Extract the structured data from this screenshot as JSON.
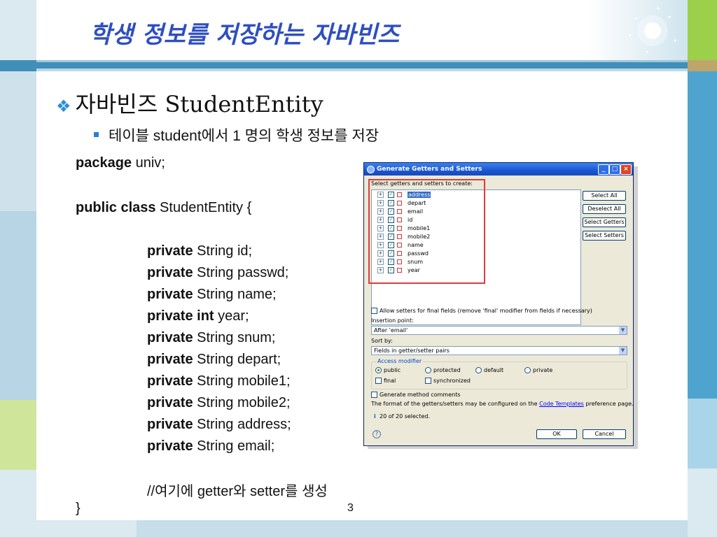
{
  "slide": {
    "title": "학생 정보를 저장하는 자바빈즈",
    "bullet1": "자바빈즈 StudentEntity",
    "bullet2": "테이블 student에서 1 명의 학생 정보를 저장",
    "page_number": "3"
  },
  "code": {
    "package_kw": "package",
    "package_rest": " univ;",
    "class_kw": "public class",
    "class_rest": " StudentEntity {",
    "fields": [
      {
        "kw": "private",
        "rest": " String id;"
      },
      {
        "kw": "private",
        "rest": " String passwd;"
      },
      {
        "kw": "private",
        "rest": " String name;"
      },
      {
        "kw": "private int",
        "rest": " year;"
      },
      {
        "kw": "private",
        "rest": " String snum;"
      },
      {
        "kw": "private",
        "rest": " String depart;"
      },
      {
        "kw": "private",
        "rest": " String mobile1;"
      },
      {
        "kw": "private",
        "rest": " String mobile2;"
      },
      {
        "kw": "private",
        "rest": " String address;"
      },
      {
        "kw": "private",
        "rest": " String email;"
      }
    ],
    "comment": "//여기에 getter와 setter를 생성",
    "close": "}"
  },
  "dialog": {
    "title": "Generate Getters and Setters",
    "select_label": "Select getters and setters to create:",
    "fields": [
      {
        "name": "address",
        "selected": true
      },
      {
        "name": "depart",
        "selected": false
      },
      {
        "name": "email",
        "selected": false
      },
      {
        "name": "id",
        "selected": false
      },
      {
        "name": "mobile1",
        "selected": false
      },
      {
        "name": "mobile2",
        "selected": false
      },
      {
        "name": "name",
        "selected": false
      },
      {
        "name": "passwd",
        "selected": false
      },
      {
        "name": "snum",
        "selected": false
      },
      {
        "name": "year",
        "selected": false
      }
    ],
    "buttons": {
      "select_all": "Select All",
      "deselect_all": "Deselect All",
      "select_getters": "Select Getters",
      "select_setters": "Select Setters",
      "ok": "OK",
      "cancel": "Cancel"
    },
    "allow_setters": "Allow setters for final fields (remove 'final' modifier from fields if necessary)",
    "insertion_label": "Insertion point:",
    "insertion_value": "After 'email'",
    "sort_label": "Sort by:",
    "sort_value": "Fields in getter/setter pairs",
    "access_modifier_label": "Access modifier",
    "modifiers": {
      "public": "public",
      "protected": "protected",
      "default": "default",
      "private": "private",
      "final": "final",
      "synchronized": "synchronized"
    },
    "generate_comments": "Generate method comments",
    "format_text": "The format of the getters/setters may be configured on the",
    "code_templates_link": "Code Templates",
    "format_text_end": "preference page.",
    "selected_count": "20 of 20 selected."
  },
  "colors": {
    "title": "#2f4fbf",
    "band": "#3f8fb8",
    "titlebar": "#1a56d3",
    "highlight_box": "#e03b3b"
  }
}
